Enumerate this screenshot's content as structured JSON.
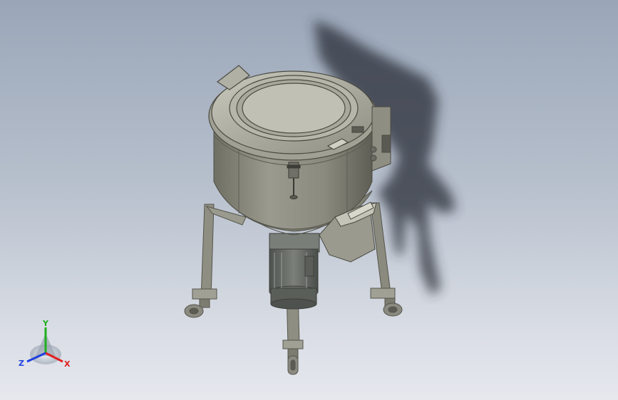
{
  "viewport": {
    "background_top": "#9aa6b8",
    "background_bottom": "#e6e8ee"
  },
  "model": {
    "body_color": "#8c8c80",
    "body_dark": "#6e6e64",
    "body_light": "#b4b4a8",
    "shadow_color": "#2a2f38",
    "motor_color": "#6a6e68"
  },
  "triad": {
    "x_label": "X",
    "y_label": "Y",
    "z_label": "Z",
    "x_color": "#e02020",
    "y_color": "#20b020",
    "z_color": "#2040e0"
  }
}
